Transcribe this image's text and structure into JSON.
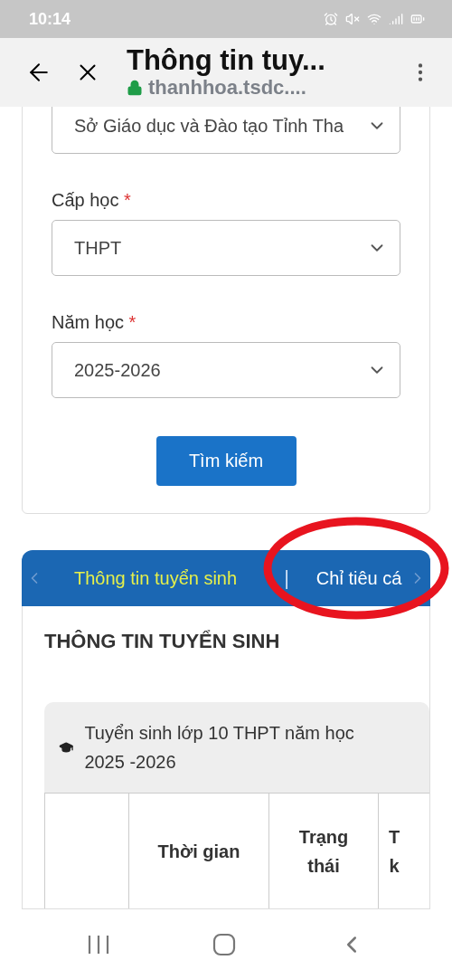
{
  "status_bar": {
    "time": "10:14"
  },
  "browser": {
    "title": "Thông tin tuy...",
    "url": "thanhhoa.tsdc...."
  },
  "form": {
    "fields": [
      {
        "value": "Sở Giáo dục và Đào tạo Tỉnh Tha"
      },
      {
        "label": "Cấp học",
        "value": "THPT",
        "required": true
      },
      {
        "label": "Năm học",
        "value": "2025-2026",
        "required": true
      }
    ],
    "required_mark": "*",
    "search_button": "Tìm kiếm"
  },
  "tabs": [
    {
      "label": "Thông tin tuyển sinh",
      "selected": true
    },
    {
      "label": "Chỉ tiêu cá",
      "selected": false
    }
  ],
  "tab_separator": "|",
  "section_title": "THÔNG TIN TUYỂN SINH",
  "card": {
    "title": "Tuyển sinh lớp 10 THPT năm học 2025 -2026",
    "table": {
      "columns": [
        "",
        "Thời gian",
        "Trạng thái",
        "T k"
      ]
    }
  }
}
